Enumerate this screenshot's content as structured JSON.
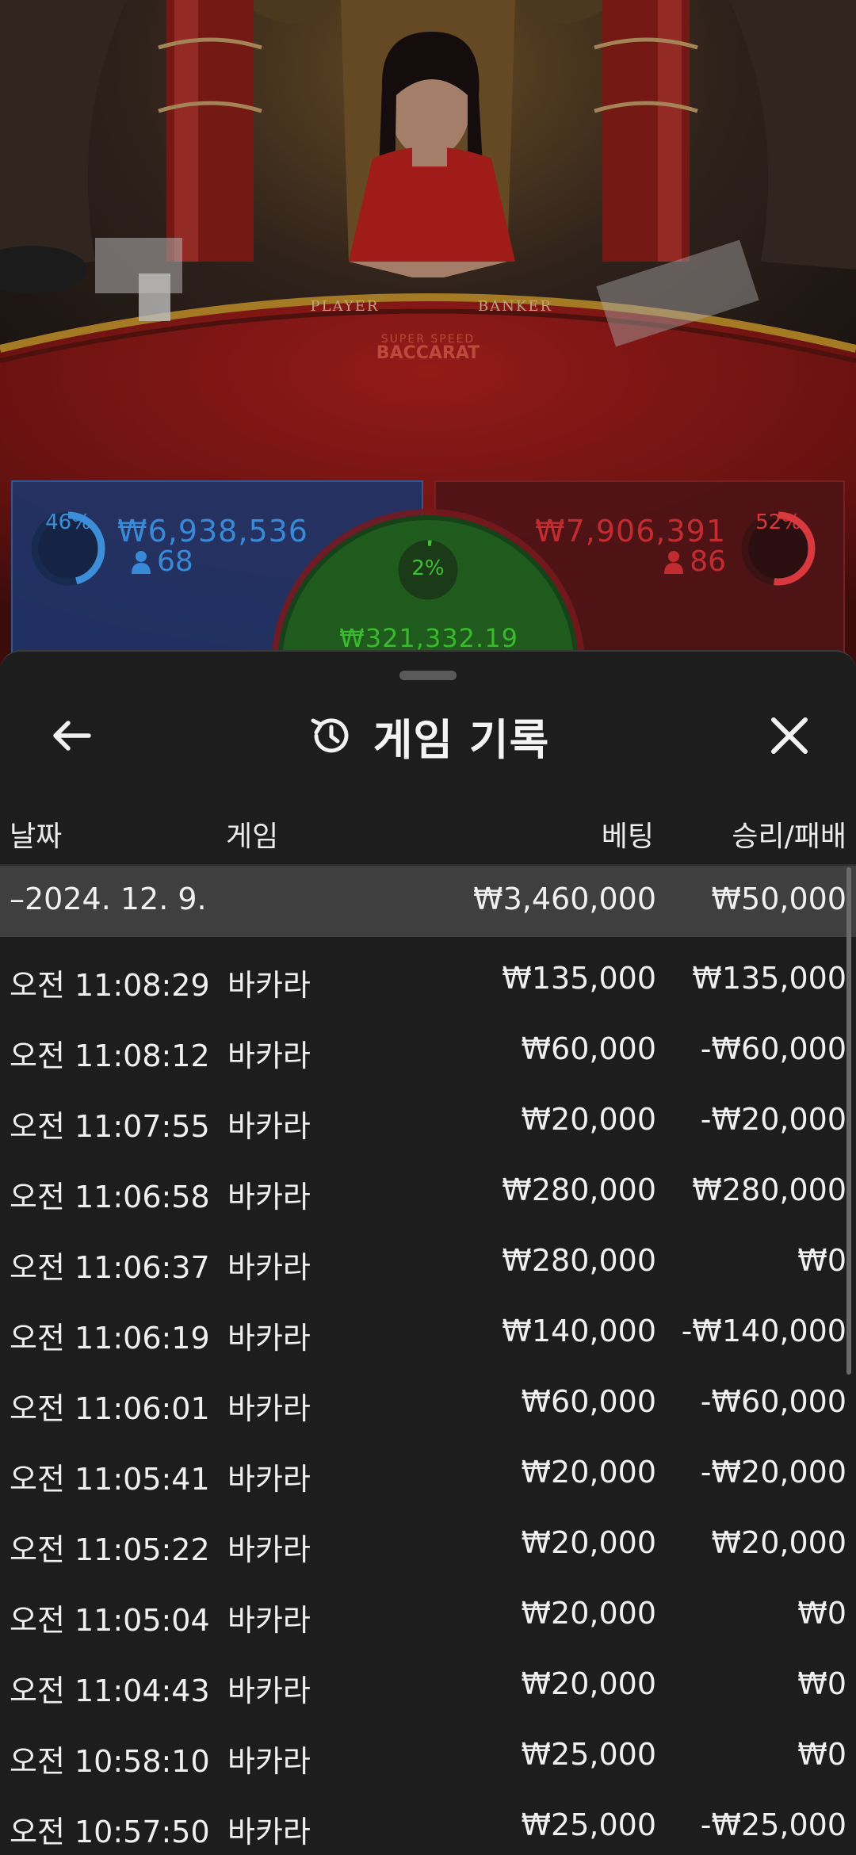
{
  "table": {
    "player_label": "PLAYER",
    "banker_label": "BANKER",
    "logo_top": "SUPER SPEED",
    "logo_bottom": "BACCARAT"
  },
  "bets": {
    "player": {
      "percent": "46%",
      "percent_value": 0.46,
      "amount": "₩6,938,536",
      "players": "68",
      "color": "#3889d6"
    },
    "banker": {
      "percent": "52%",
      "percent_value": 0.52,
      "amount": "₩7,906,391",
      "players": "86",
      "color": "#c22c30"
    },
    "tie": {
      "percent": "2%",
      "percent_value": 0.02,
      "amount": "₩321,332.19",
      "color": "#39b92d"
    }
  },
  "sheet": {
    "title": "게임 기록",
    "back_icon": "arrow-left-icon",
    "history_icon": "history-icon",
    "close_icon": "close-icon"
  },
  "columns": {
    "date": "날짜",
    "game": "게임",
    "bet": "베팅",
    "win_loss": "승리/패배"
  },
  "day_group": {
    "date": "–2024. 12. 9.",
    "bet_total": "₩3,460,000",
    "win_total": "₩50,000"
  },
  "rows": [
    {
      "time": "오전 11:08:29",
      "game": "바카라",
      "bet": "₩135,000",
      "result": "₩135,000"
    },
    {
      "time": "오전 11:08:12",
      "game": "바카라",
      "bet": "₩60,000",
      "result": "-₩60,000"
    },
    {
      "time": "오전 11:07:55",
      "game": "바카라",
      "bet": "₩20,000",
      "result": "-₩20,000"
    },
    {
      "time": "오전 11:06:58",
      "game": "바카라",
      "bet": "₩280,000",
      "result": "₩280,000"
    },
    {
      "time": "오전 11:06:37",
      "game": "바카라",
      "bet": "₩280,000",
      "result": "₩0"
    },
    {
      "time": "오전 11:06:19",
      "game": "바카라",
      "bet": "₩140,000",
      "result": "-₩140,000"
    },
    {
      "time": "오전 11:06:01",
      "game": "바카라",
      "bet": "₩60,000",
      "result": "-₩60,000"
    },
    {
      "time": "오전 11:05:41",
      "game": "바카라",
      "bet": "₩20,000",
      "result": "-₩20,000"
    },
    {
      "time": "오전 11:05:22",
      "game": "바카라",
      "bet": "₩20,000",
      "result": "₩20,000"
    },
    {
      "time": "오전 11:05:04",
      "game": "바카라",
      "bet": "₩20,000",
      "result": "₩0"
    },
    {
      "time": "오전 11:04:43",
      "game": "바카라",
      "bet": "₩20,000",
      "result": "₩0"
    },
    {
      "time": "오전 10:58:10",
      "game": "바카라",
      "bet": "₩25,000",
      "result": "₩0"
    },
    {
      "time": "오전 10:57:50",
      "game": "바카라",
      "bet": "₩25,000",
      "result": "-₩25,000"
    }
  ]
}
